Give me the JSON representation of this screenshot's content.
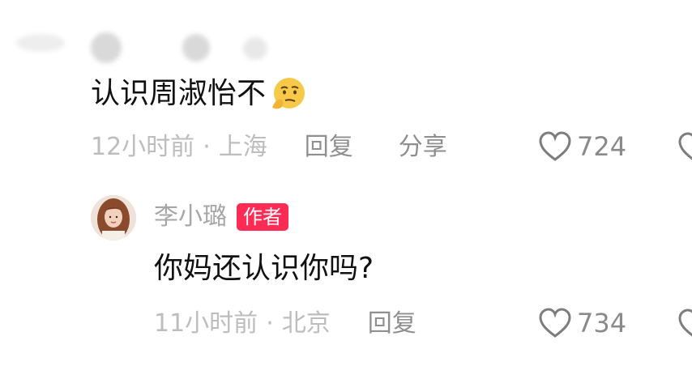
{
  "main_comment": {
    "text": "认识周淑怡不",
    "emoji": "thinking-face-emoji",
    "time": "12小时前",
    "separator": "·",
    "location": "上海",
    "reply_label": "回复",
    "share_label": "分享",
    "like_count": "724"
  },
  "reply": {
    "author": "李小璐",
    "badge": "作者",
    "text": "你妈还认识你吗?",
    "time": "11小时前",
    "separator": "·",
    "location": "北京",
    "reply_label": "回复",
    "like_count": "734"
  },
  "colors": {
    "badge": "#fe2c55",
    "meta_text": "#b3b3b3",
    "action_text": "#8f8f8f"
  }
}
